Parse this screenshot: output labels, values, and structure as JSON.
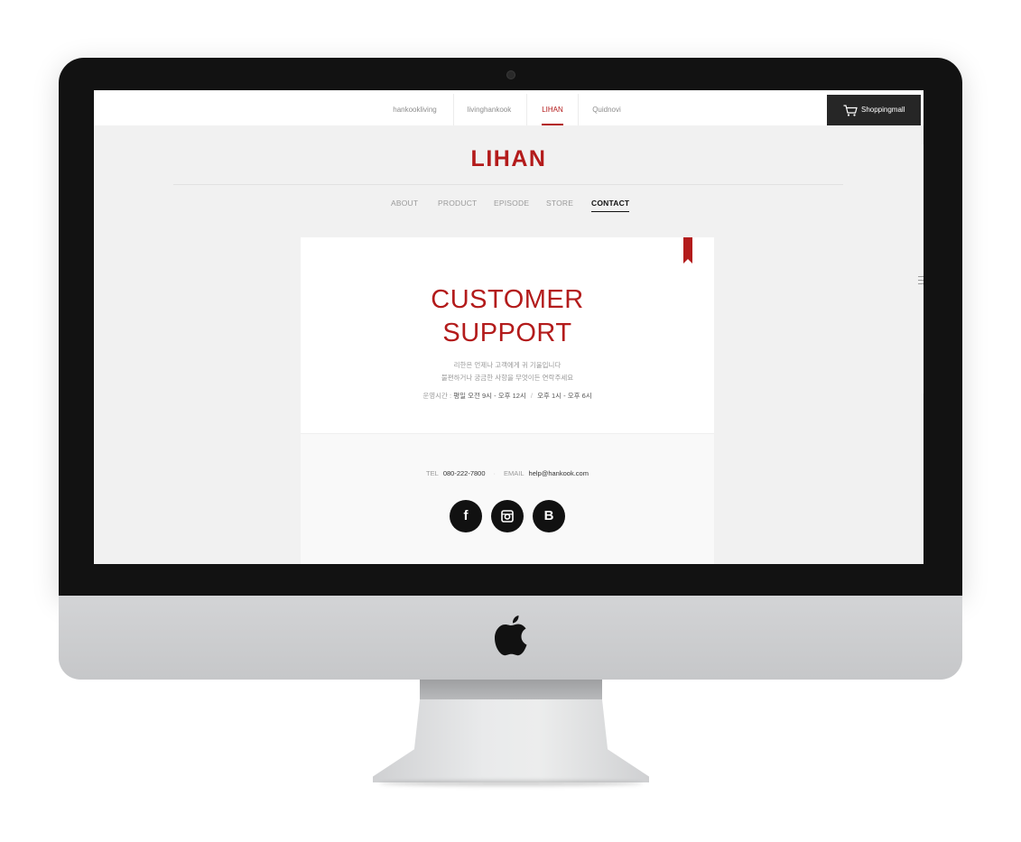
{
  "brand_nav": {
    "items": [
      {
        "label": "hankookliving",
        "active": false
      },
      {
        "label": "livinghankook",
        "active": false
      },
      {
        "label": "LIHAN",
        "active": true
      },
      {
        "label": "Quidnovi",
        "active": false
      }
    ],
    "shop_label": "Shoppingmall"
  },
  "logo": "LIHAN",
  "main_nav": {
    "items": [
      {
        "label": "ABOUT",
        "active": false
      },
      {
        "label": "PRODUCT",
        "active": false
      },
      {
        "label": "EPISODE",
        "active": false
      },
      {
        "label": "STORE",
        "active": false
      },
      {
        "label": "CONTACT",
        "active": true
      }
    ]
  },
  "support": {
    "title_line1": "CUSTOMER",
    "title_line2": "SUPPORT",
    "desc_line1": "리한은 언제나 고객에게 귀 기울입니다",
    "desc_line2": "불편하거나 궁금한 사항을 무엇이든 연락주세요",
    "hours_label": "운영시간 :",
    "hours_am": "평일 오전 9시 - 오후 12시",
    "hours_sep": "/",
    "hours_pm": "오후 1시 - 오후 6시"
  },
  "contact": {
    "tel_label": "TEL",
    "tel": "080-222-7800",
    "email_label": "EMAIL",
    "email": "help@hankook.com"
  },
  "social": [
    "facebook-icon",
    "instagram-icon",
    "blog-icon"
  ],
  "colors": {
    "accent": "#b31b1b",
    "dark": "#262626",
    "page_bg": "#f1f1f1"
  }
}
